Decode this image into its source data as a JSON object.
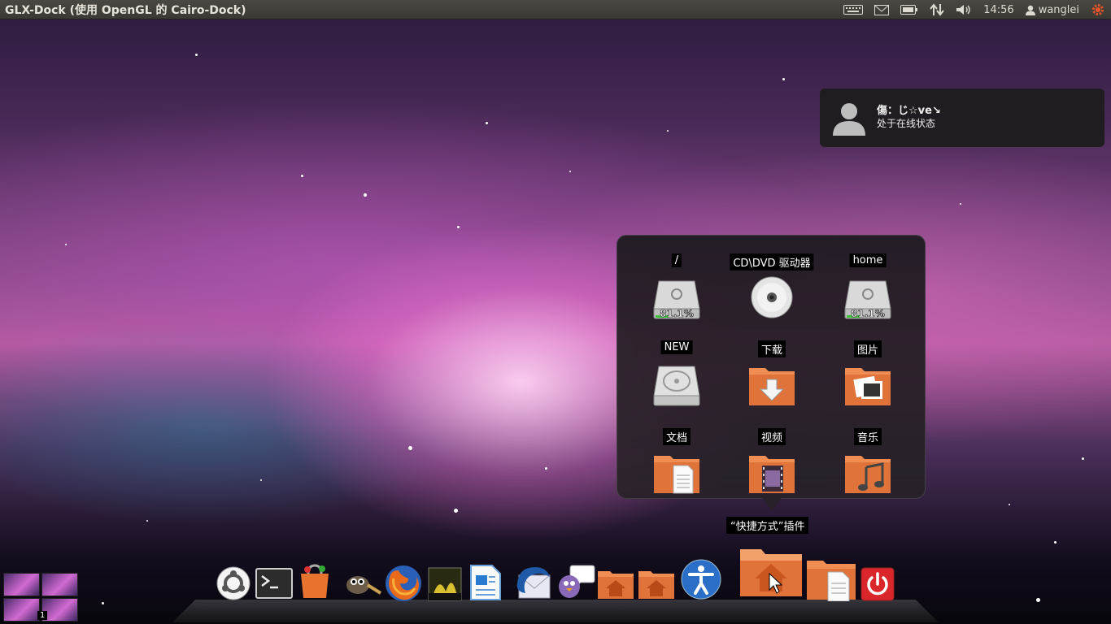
{
  "top_panel": {
    "window_title": "GLX-Dock (使用 OpenGL 的 Cairo-Dock)",
    "clock": "14:56",
    "user": "wanglei",
    "indicator_icons": [
      "keyboard-icon",
      "mail-icon",
      "battery-icon",
      "network-icon",
      "volume-icon",
      "user-icon",
      "session-gear-icon"
    ]
  },
  "notification": {
    "title": "傷：じ☆ve↘",
    "body": "处于在线状态"
  },
  "stack": {
    "items": [
      {
        "label": "/",
        "icon": "drive-icon",
        "usage": "81.1%"
      },
      {
        "label": "CD\\DVD 驱动器",
        "icon": "cdrom-icon"
      },
      {
        "label": "home",
        "icon": "drive-icon",
        "usage": "81.1%"
      },
      {
        "label": "NEW",
        "icon": "harddisk-icon"
      },
      {
        "label": "下载",
        "icon": "folder-download-icon"
      },
      {
        "label": "图片",
        "icon": "folder-pictures-icon"
      },
      {
        "label": "文档",
        "icon": "folder-documents-icon"
      },
      {
        "label": "视频",
        "icon": "folder-videos-icon"
      },
      {
        "label": "音乐",
        "icon": "folder-music-icon"
      }
    ]
  },
  "dock": {
    "hover_label": "“快捷方式”插件",
    "items": [
      "ubuntu-icon",
      "terminal-icon",
      "software-center-icon",
      "gimp-icon",
      "firefox-icon",
      "image-viewer-icon",
      "writer-icon",
      "thunderbird-icon",
      "pidgin-icon",
      "home-folder-icon",
      "home-folder-icon",
      "accessibility-icon",
      "shortcuts-home-icon",
      "documents-folder-icon",
      "shutdown-icon"
    ]
  },
  "workspaces": {
    "current": "1"
  },
  "colors": {
    "panel": "#3c3b37",
    "folder_orange": "#e0733a",
    "accent_red": "#dd4814"
  }
}
